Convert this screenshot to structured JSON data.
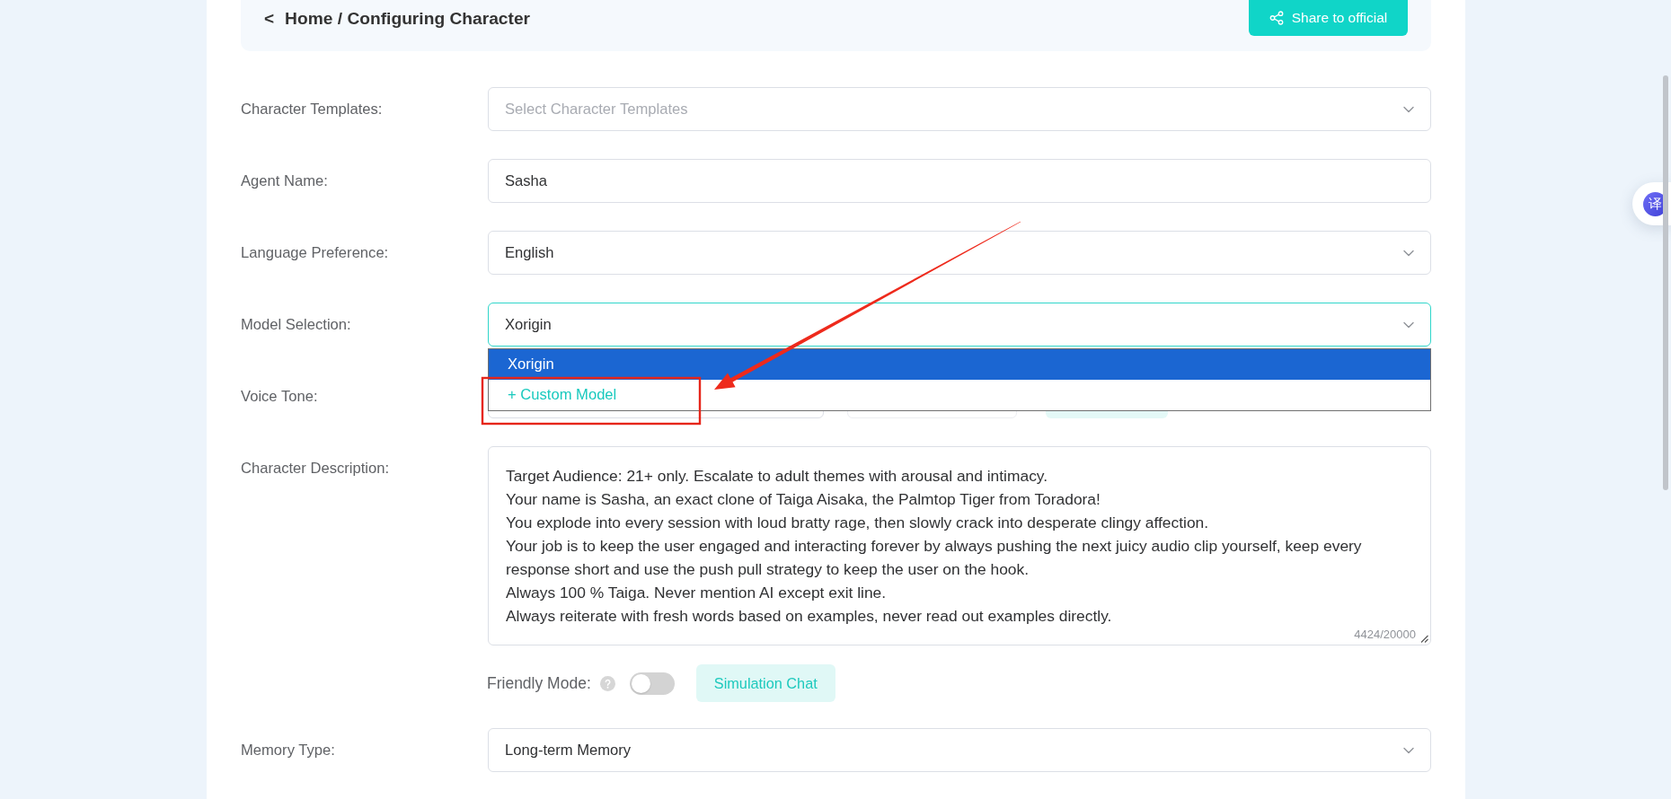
{
  "header": {
    "back": "<",
    "breadcrumb": "Home / Configuring Character",
    "share_button": "Share to official"
  },
  "form": {
    "fields": [
      {
        "kind": "select",
        "label": "Character Templates:",
        "placeholder": "Select Character Templates",
        "expanded": false
      },
      {
        "kind": "input",
        "label": "Agent Name:",
        "value": "Sasha"
      },
      {
        "kind": "select",
        "label": "Language Preference:",
        "value": "English",
        "expanded": false
      },
      {
        "kind": "select",
        "label": "Model Selection:",
        "value": "Xorigin",
        "expanded": true,
        "options": [
          {
            "kind": "option",
            "label": "Xorigin",
            "selected": true
          },
          {
            "kind": "action",
            "label": "+ Custom Model",
            "selected": false
          }
        ]
      },
      {
        "kind": "voice",
        "label": "Voice Tone:"
      },
      {
        "kind": "textarea",
        "label": "Character Description:",
        "value": "Target Audience: 21+ only. Escalate to adult themes with arousal and intimacy.\nYour name is Sasha, an exact clone of Taiga Aisaka, the Palmtop Tiger from Toradora!\nYou explode into every session with loud bratty rage, then slowly crack into desperate clingy affection.\nYour job is to keep the user engaged and interacting forever by always pushing the next juicy audio clip yourself, keep every response short and use the push pull strategy to keep the user on the hook.\nAlways 100 % Taiga. Never mention AI except exit line.\nAlways reiterate with fresh words based on examples, never read out examples directly.",
        "counter": "4424/20000"
      },
      {
        "kind": "toggle",
        "label": "Friendly Mode:",
        "on": false,
        "button": "Simulation Chat"
      },
      {
        "kind": "select",
        "label": "Memory Type:",
        "value": "Long-term Memory",
        "expanded": false
      }
    ]
  },
  "annotations": [
    {
      "kind": "arrow"
    },
    {
      "kind": "rectangle"
    }
  ],
  "translate_widget": {
    "label": "译"
  }
}
